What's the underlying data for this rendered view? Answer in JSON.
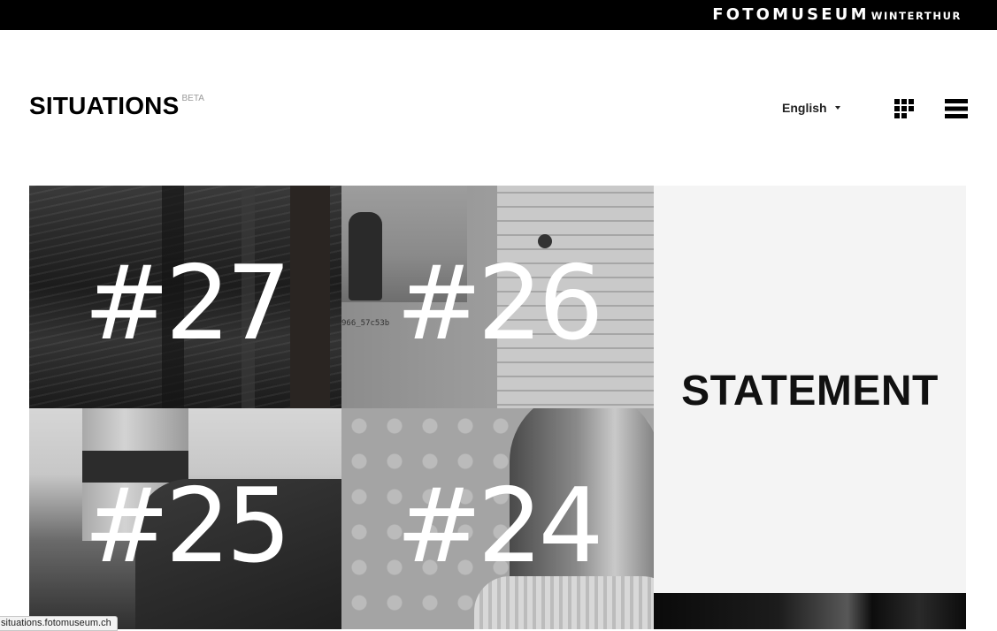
{
  "header": {
    "brand_main": "FOTOMUSEUM",
    "brand_sub": "WINTERTHUR"
  },
  "site": {
    "title": "SITUATIONS",
    "badge": "BETA"
  },
  "nav": {
    "language": "English",
    "grid_view_icon": "grid-icon",
    "menu_icon": "hamburger-icon"
  },
  "tiles": [
    {
      "label": "#27"
    },
    {
      "label": "#26",
      "caption": "966_57c53b"
    },
    {
      "label": "#25"
    },
    {
      "label": "#24"
    }
  ],
  "statement": {
    "label": "STATEMENT"
  },
  "status": {
    "url": "situations.fotomuseum.ch"
  },
  "colors": {
    "topbar": "#000000",
    "background": "#ffffff",
    "statement_bg": "#f4f4f4",
    "badge": "#9a9a9a"
  }
}
